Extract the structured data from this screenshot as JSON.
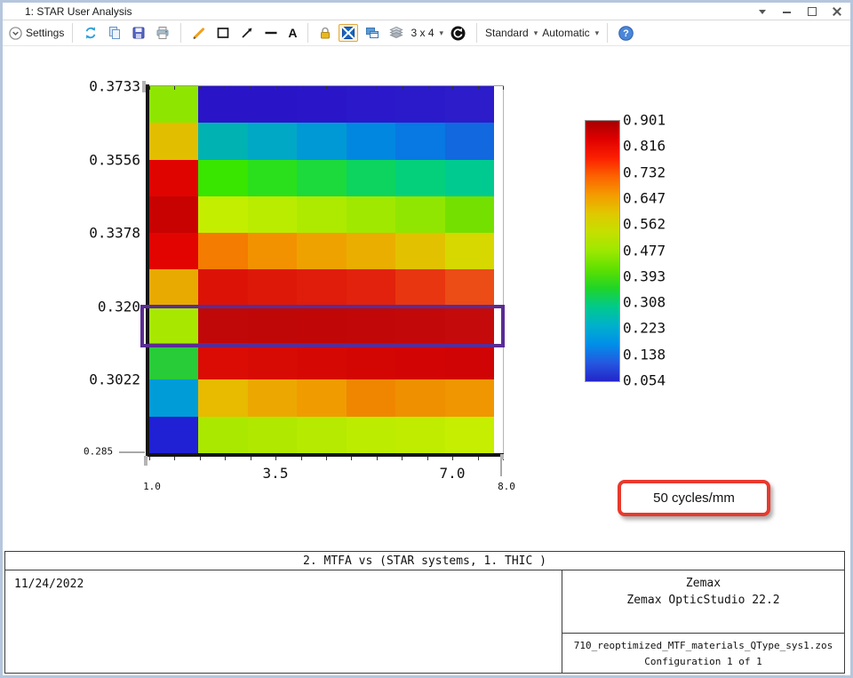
{
  "window": {
    "title": "1: STAR User Analysis"
  },
  "icons": {
    "caret": "▾",
    "help_glyph": "?"
  },
  "toolbar": {
    "settings_label": "Settings",
    "text_tool_label": "A",
    "grid_size_label": "3 x 4",
    "standard_label": "Standard",
    "automatic_label": "Automatic"
  },
  "chart_data": {
    "type": "heatmap",
    "title": "2. MTFA vs (STAR systems, 1. THIC )",
    "x_axis": {
      "min": 1.0,
      "max": 8.0,
      "major_ticks": [
        "3.5",
        "7.0"
      ],
      "end_labels": [
        "1.0",
        "8.0"
      ]
    },
    "y_axis": {
      "min": 0.285,
      "max": 0.3733,
      "major_ticks": [
        "0.3733",
        "0.3556",
        "0.3378",
        "0.320",
        "0.3022"
      ],
      "end_label": "0.285"
    },
    "rows": 10,
    "cols": 7,
    "value_range": [
      0.054,
      0.901
    ],
    "cell_colors": [
      [
        "#8ee600",
        "#2a14c8",
        "#2a14c8",
        "#2a16c8",
        "#2a18ca",
        "#2b1aca",
        "#2c1cca"
      ],
      [
        "#e2be00",
        "#00b2b2",
        "#00a8c6",
        "#0099d6",
        "#0187e0",
        "#0878e2",
        "#1268de"
      ],
      [
        "#e00400",
        "#38e600",
        "#2ae01c",
        "#1cda3c",
        "#0cd45e",
        "#04d07c",
        "#00ca90"
      ],
      [
        "#c80200",
        "#c4ee00",
        "#baec00",
        "#aeea00",
        "#a0e800",
        "#90e600",
        "#74e000"
      ],
      [
        "#e20400",
        "#f47c00",
        "#f29200",
        "#eea200",
        "#eaae00",
        "#e2c200",
        "#d6d800"
      ],
      [
        "#e8aa00",
        "#dc1206",
        "#de1808",
        "#e01c0a",
        "#e2220c",
        "#e83610",
        "#ec4c16"
      ],
      [
        "#a8e800",
        "#c00808",
        "#c00707",
        "#c00606",
        "#c10707",
        "#c20808",
        "#c40a0a"
      ],
      [
        "#28cc38",
        "#da0c04",
        "#d80a04",
        "#d60804",
        "#d40604",
        "#d20504",
        "#d00404"
      ],
      [
        "#009cd8",
        "#e8ba00",
        "#eca800",
        "#f09c00",
        "#f08600",
        "#ee9000",
        "#f09600"
      ],
      [
        "#2020d4",
        "#aae800",
        "#b0e800",
        "#b6ea00",
        "#bcec00",
        "#c0ec00",
        "#c6ee00"
      ]
    ],
    "highlight": {
      "row_index": 6,
      "color": "#5a2c94"
    },
    "colorbar": {
      "labels": [
        "0.901",
        "0.816",
        "0.732",
        "0.647",
        "0.562",
        "0.477",
        "0.393",
        "0.308",
        "0.223",
        "0.138",
        "0.054"
      ],
      "gradient": [
        "#a80000",
        "#e00000",
        "#fc2000",
        "#fc6400",
        "#f49c00",
        "#e0c800",
        "#c4e000",
        "#9ce800",
        "#5ee000",
        "#20d428",
        "#00ca8c",
        "#00b0cc",
        "#0090e8",
        "#2458e0",
        "#2424c8"
      ]
    }
  },
  "annotation": {
    "label": "50 cycles/mm",
    "border_color": "#e8392e"
  },
  "footer": {
    "title": "2. MTFA vs (STAR systems, 1. THIC )",
    "date": "11/24/2022",
    "brand_line1": "Zemax",
    "brand_line2": "Zemax OpticStudio 22.2",
    "file_name": "710_reoptimized_MTF_materials_QType_sys1.zos",
    "config": "Configuration 1 of 1"
  }
}
